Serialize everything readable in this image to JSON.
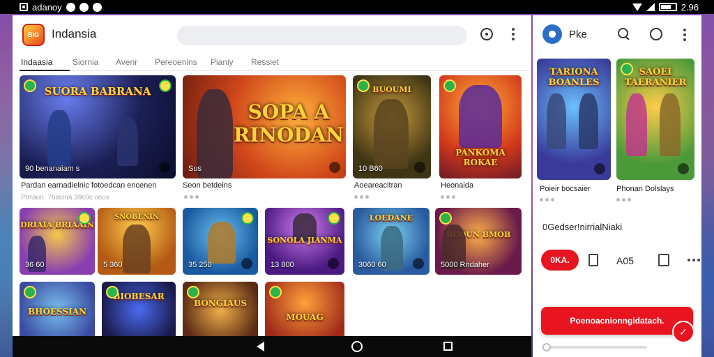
{
  "status_bar": {
    "app_label": "adanoy",
    "time": "2.96"
  },
  "header": {
    "title": "Indansia",
    "logo_text": "BIG"
  },
  "tabs": [
    {
      "label": "Indaasia"
    },
    {
      "label": "Siornia"
    },
    {
      "label": "Avenr"
    },
    {
      "label": "Pereoenins"
    },
    {
      "label": "Pianiy"
    },
    {
      "label": "Ressiet"
    }
  ],
  "featured": [
    {
      "card_text": "90 benanaiam s",
      "caption": "Pardan earnadielnic fotoedcan encenen",
      "art_title": "SUORA BABRANA",
      "sub_caption": ""
    },
    {
      "card_text": "Sus",
      "caption": "Seon betdeins",
      "art_title": "SOPA A RINODAN",
      "sub_caption": ""
    },
    {
      "card_text": "10 B60",
      "caption": "Aoeareacitran",
      "art_title": "BUOUMI",
      "sub_caption": ""
    },
    {
      "card_text": "",
      "caption": "Heonaida",
      "art_title": "PANKOMA ROKAE",
      "sub_caption": ""
    }
  ],
  "row2_sub_caption": "Ptrraun. 76acina 39c0c ceus",
  "row2": [
    {
      "card_text": "36 60",
      "art_title": "DRIAIA BRIAAIN"
    },
    {
      "card_text": "5 360",
      "art_title": "SNOBENIN"
    },
    {
      "card_text": "35 250",
      "art_title": ""
    },
    {
      "card_text": "13 800",
      "art_title": "SONOLA JIANMA"
    },
    {
      "card_text": "3060 60",
      "art_title": "LOEDANE"
    },
    {
      "card_text": "5000 Rndaher",
      "art_title": "BUOUN BMOB"
    }
  ],
  "row3": [
    {
      "art_title": "BHOESSIAN"
    },
    {
      "art_title": "BIOBESAR"
    },
    {
      "art_title": "BONGIAUS"
    },
    {
      "art_title": "MOUAG"
    }
  ],
  "side": {
    "title": "Pke",
    "cards": [
      {
        "art_title": "TARIONA BOANLES",
        "caption": "Poieir bocsaier"
      },
      {
        "art_title": "SAOEI TAERANIER",
        "caption": "Phonan Dolslays"
      }
    ],
    "heading": "0Gedser!nirrialNiaki",
    "pill_label": "0KA.",
    "label": "A05",
    "cta_label": "Poenoacnionngidatach."
  },
  "colors": {
    "accent": "#e8141f",
    "tab_active": "#222222",
    "status_bar": "#000000"
  }
}
